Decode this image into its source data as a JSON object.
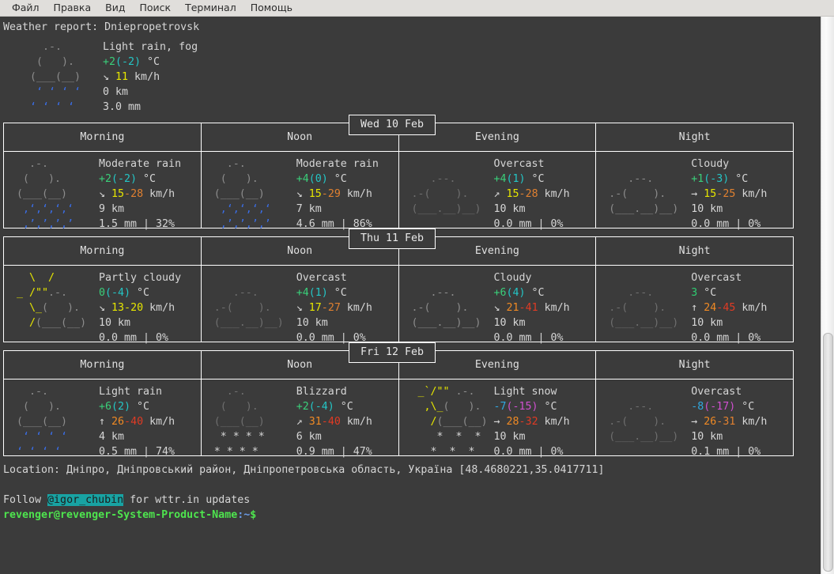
{
  "menubar": {
    "items": [
      {
        "label": "Файл"
      },
      {
        "label": "Правка"
      },
      {
        "label": "Вид"
      },
      {
        "label": "Поиск"
      },
      {
        "label": "Терминал"
      },
      {
        "label": "Помощь"
      }
    ]
  },
  "report": {
    "header": "Weather report: Dniepropetrovsk",
    "location_line": "Location: Дніпро, Дніпровський район, Дніпропетровська область, Україна [48.4680221,35.0417711]",
    "follow_prefix": "Follow ",
    "follow_handle": "@igor_chubin",
    "follow_suffix": " for wttr.in updates",
    "prompt_user": "revenger@revenger-System-Product-Name",
    "prompt_path": ":~",
    "prompt_symbol": "$"
  },
  "current": {
    "art": [
      "    .-.    ",
      "   (   ).  ",
      "  (___(__) ",
      " ‘ ‘ ‘ ‘ ‘ ",
      "‘ ‘ ‘ ‘ ‘  "
    ],
    "condition": "Light rain, fog",
    "temp": "+2",
    "temp_feels": "(-2)",
    "temp_unit": " °C",
    "wind_arrow": "↘",
    "wind_speed": "11",
    "wind_unit": " km/h",
    "visibility": "0 km",
    "precip": "3.0 mm"
  },
  "columns": [
    "Morning",
    "Noon",
    "Evening",
    "Night"
  ],
  "days": [
    {
      "date": "Wed 10 Feb",
      "cells": [
        {
          "icon": "rain-heavy-icon",
          "condition": "Moderate rain",
          "temp": "+2",
          "temp_feels": "(-2)",
          "temp_unit": " °C",
          "wind_arrow": "↘",
          "wind_lo": "15",
          "wind_dash": "-",
          "wind_hi": "28",
          "wind_hi_color": "#e08030",
          "wind_unit": " km/h",
          "visibility": "9 km",
          "precip": "1.5 mm | 32%"
        },
        {
          "icon": "rain-heavy-icon",
          "condition": "Moderate rain",
          "temp": "+4",
          "temp_feels": "(0)",
          "temp_unit": " °C",
          "wind_arrow": "↘",
          "wind_lo": "15",
          "wind_dash": "-",
          "wind_hi": "29",
          "wind_hi_color": "#e08030",
          "wind_unit": " km/h",
          "visibility": "7 km",
          "precip": "4.6 mm | 86%"
        },
        {
          "icon": "overcast-icon",
          "condition": "Overcast",
          "temp": "+4",
          "temp_feels": "(1)",
          "temp_unit": " °C",
          "wind_arrow": "↗",
          "wind_lo": "15",
          "wind_dash": "-",
          "wind_hi": "28",
          "wind_hi_color": "#e08030",
          "wind_unit": " km/h",
          "visibility": "10 km",
          "precip": "0.0 mm | 0%"
        },
        {
          "icon": "cloudy-icon",
          "condition": "Cloudy",
          "temp": "+1",
          "temp_feels": "(-3)",
          "temp_unit": " °C",
          "wind_arrow": "→",
          "wind_lo": "15",
          "wind_dash": "-",
          "wind_hi": "25",
          "wind_hi_color": "#e08030",
          "wind_unit": " km/h",
          "visibility": "10 km",
          "precip": "0.0 mm | 0%"
        }
      ]
    },
    {
      "date": "Thu 11 Feb",
      "cells": [
        {
          "icon": "partly-cloudy-icon",
          "condition": "Partly cloudy",
          "temp": "0",
          "temp_feels": "(-4)",
          "temp_unit": " °C",
          "wind_arrow": "↘",
          "wind_lo": "13",
          "wind_dash": "-",
          "wind_hi": "20",
          "wind_hi_color": "#e6e600",
          "wind_unit": " km/h",
          "visibility": "10 km",
          "precip": "0.0 mm | 0%"
        },
        {
          "icon": "overcast-icon",
          "condition": "Overcast",
          "temp": "+4",
          "temp_feels": "(1)",
          "temp_unit": " °C",
          "wind_arrow": "↘",
          "wind_lo": "17",
          "wind_dash": "-",
          "wind_hi": "27",
          "wind_hi_color": "#e08030",
          "wind_unit": " km/h",
          "visibility": "10 km",
          "precip": "0.0 mm | 0%"
        },
        {
          "icon": "cloudy-icon",
          "condition": "Cloudy",
          "temp": "+6",
          "temp_feels": "(4)",
          "temp_unit": " °C",
          "wind_arrow": "↘",
          "wind_lo": "21",
          "wind_dash": "-",
          "wind_hi": "41",
          "wind_hi_color": "#e03b24",
          "wind_unit": " km/h",
          "visibility": "10 km",
          "precip": "0.0 mm | 0%"
        },
        {
          "icon": "overcast-icon",
          "condition": "Overcast",
          "temp": "3",
          "temp_feels": "",
          "temp_unit": " °C",
          "wind_arrow": "↑",
          "wind_lo": "24",
          "wind_dash": "-",
          "wind_hi": "45",
          "wind_hi_color": "#e03b24",
          "wind_unit": " km/h",
          "visibility": "10 km",
          "precip": "0.0 mm | 0%"
        }
      ]
    },
    {
      "date": "Fri 12 Feb",
      "cells": [
        {
          "icon": "light-rain-icon",
          "condition": "Light rain",
          "temp": "+6",
          "temp_feels": "(2)",
          "temp_unit": " °C",
          "wind_arrow": "↑",
          "wind_lo": "26",
          "wind_dash": "-",
          "wind_hi": "40",
          "wind_hi_color": "#e03b24",
          "wind_unit": " km/h",
          "visibility": "4 km",
          "precip": "0.5 mm | 74%"
        },
        {
          "icon": "blizzard-icon",
          "condition": "Blizzard",
          "temp": "+2",
          "temp_feels": "(-4)",
          "temp_unit": " °C",
          "wind_arrow": "↗",
          "wind_lo": "31",
          "wind_dash": "-",
          "wind_hi": "40",
          "wind_hi_color": "#e03b24",
          "wind_unit": " km/h",
          "visibility": "6 km",
          "precip": "0.9 mm | 47%"
        },
        {
          "icon": "light-snow-icon",
          "condition": "Light snow",
          "temp": "-7",
          "temp_feels": "(-15)",
          "temp_unit": " °C",
          "temp_color": "#2fa8e0",
          "feels_color": "#d050d0",
          "wind_arrow": "→",
          "wind_lo": "28",
          "wind_dash": "-",
          "wind_hi": "32",
          "wind_hi_color": "#e03b24",
          "wind_unit": " km/h",
          "visibility": "10 km",
          "precip": "0.0 mm | 0%"
        },
        {
          "icon": "overcast-icon",
          "condition": "Overcast",
          "temp": "-8",
          "temp_feels": "(-17)",
          "temp_unit": " °C",
          "temp_color": "#2fa8e0",
          "feels_color": "#d050d0",
          "wind_arrow": "→",
          "wind_lo": "26",
          "wind_dash": "-",
          "wind_hi": "31",
          "wind_hi_color": "#e08030",
          "wind_unit": " km/h",
          "visibility": "10 km",
          "precip": "0.1 mm | 0%"
        }
      ]
    }
  ]
}
